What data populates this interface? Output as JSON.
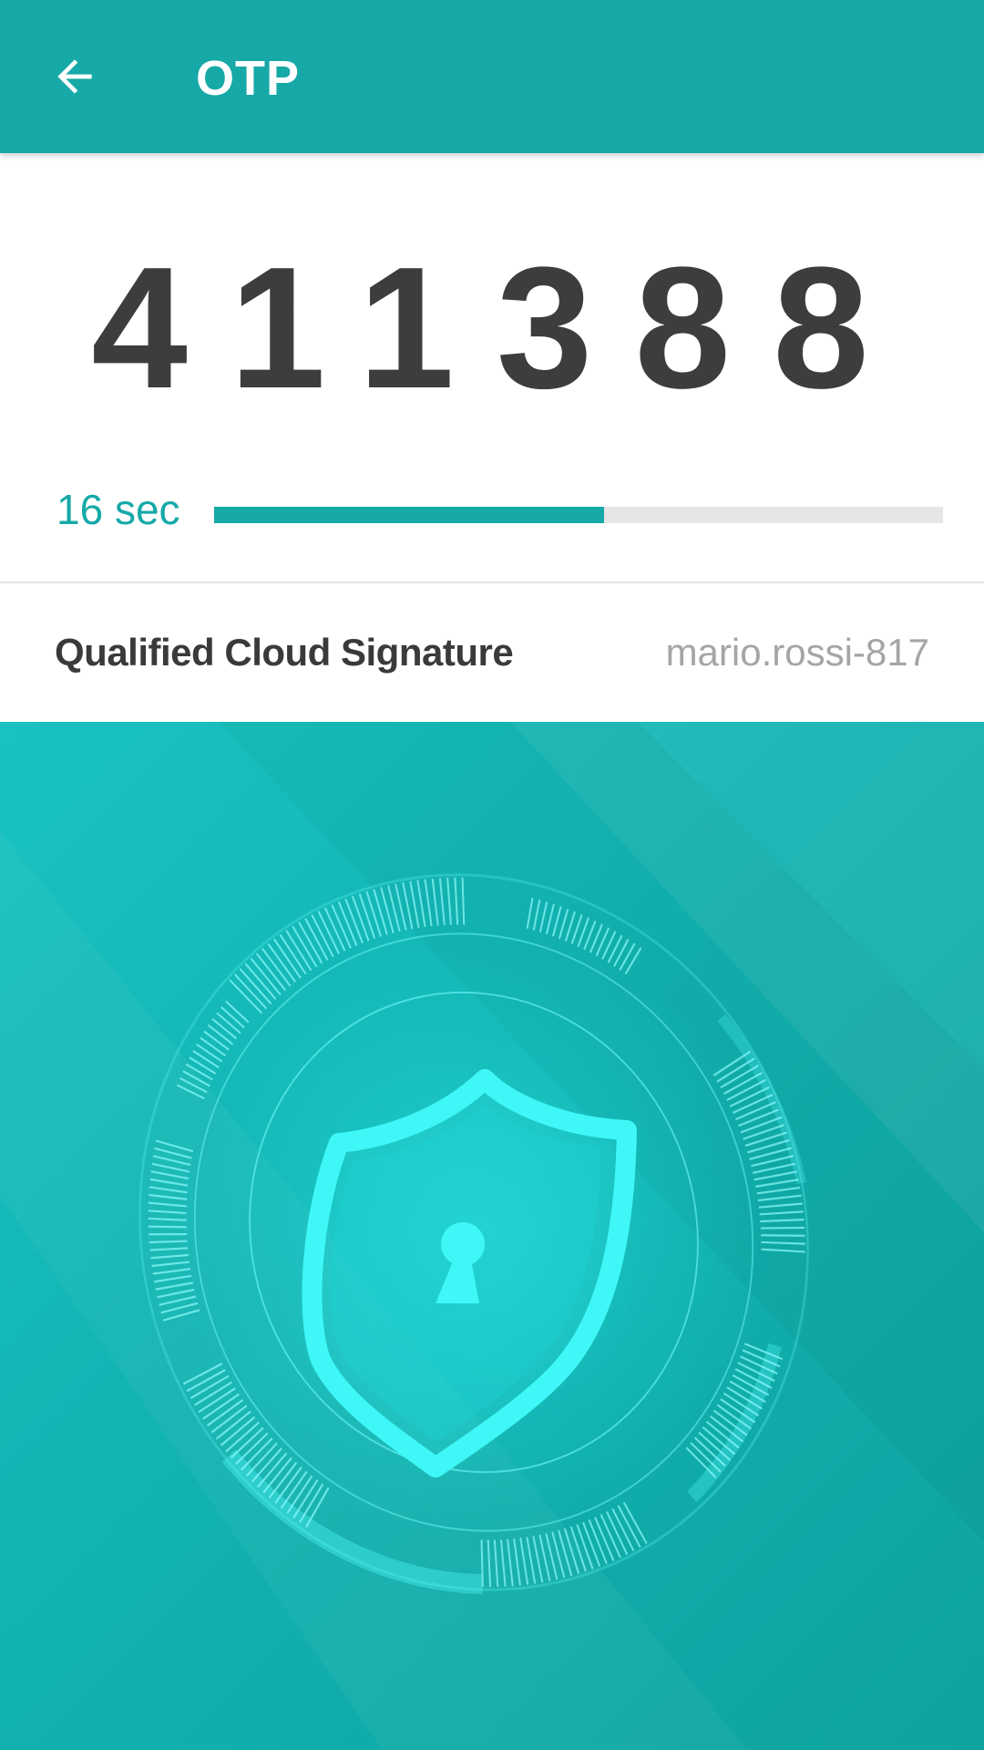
{
  "appbar": {
    "title": "OTP",
    "back_icon": "arrow-back-icon",
    "color": "#16a9a7"
  },
  "otp": {
    "code": "411388",
    "timer_label": "16 sec",
    "remaining_fraction": 0.535
  },
  "service": {
    "name": "Qualified Cloud Signature",
    "user": "mario.rossi-817"
  },
  "illustration": {
    "icon": "shield-lock-icon",
    "accent": "#3ff7f7"
  }
}
